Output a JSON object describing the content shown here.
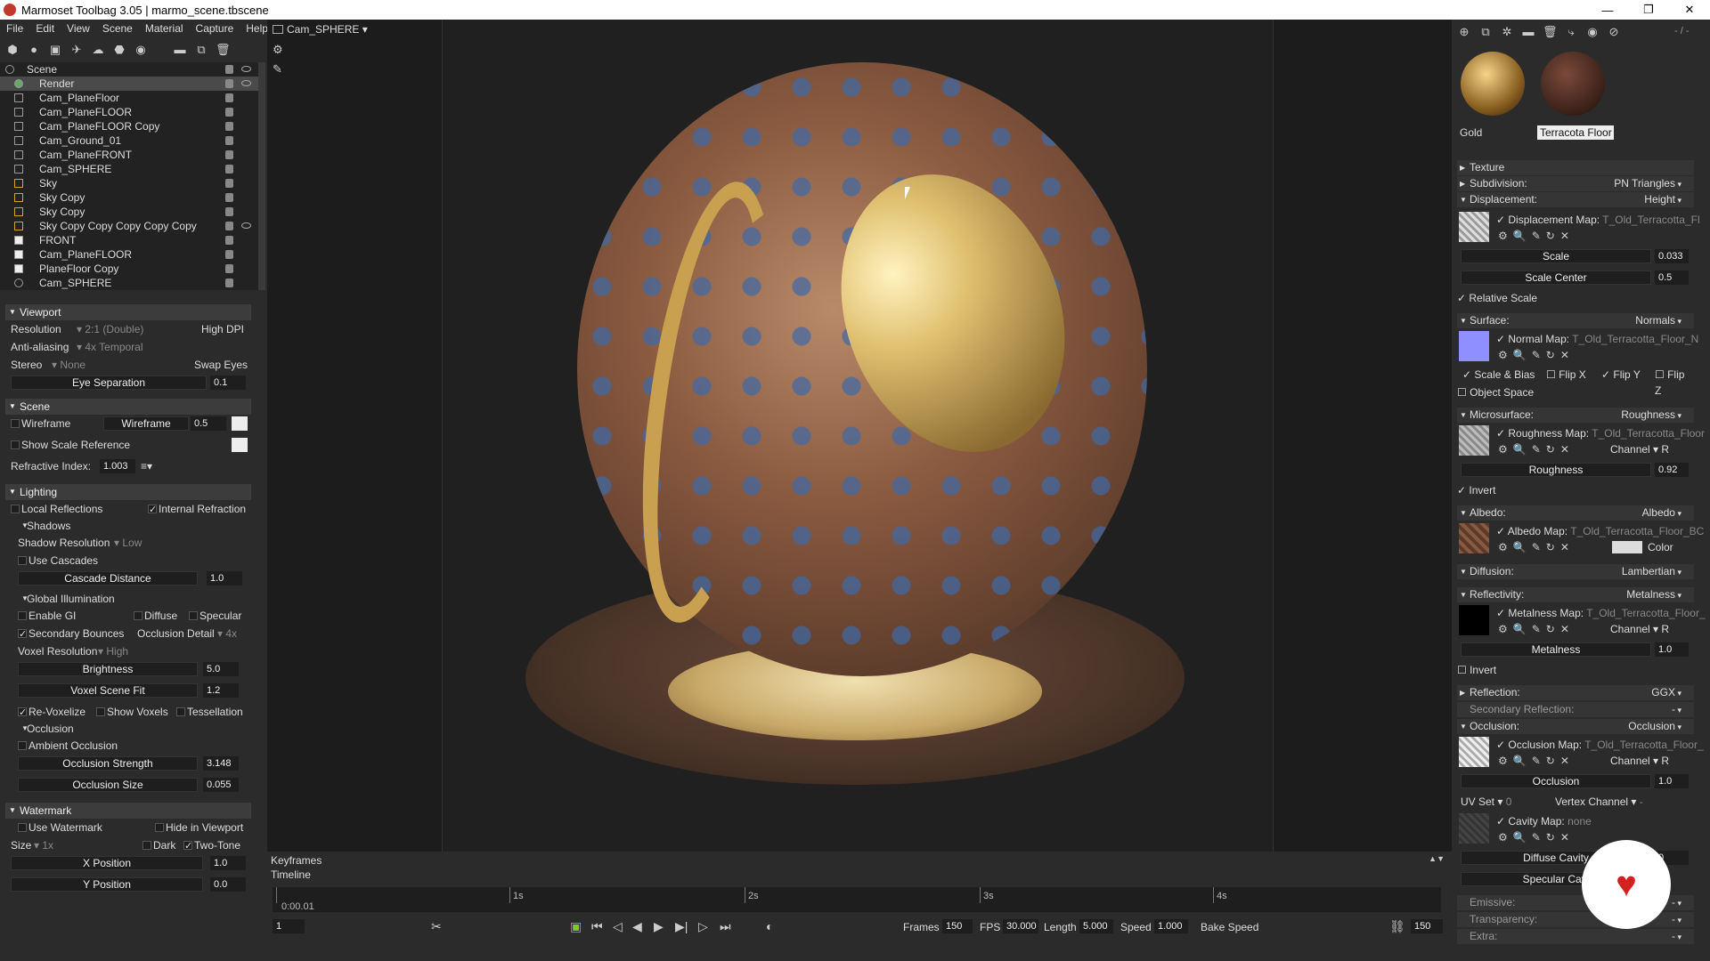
{
  "titlebar": {
    "app": "Marmoset Toolbag 3.05",
    "file": "marmo_scene.tbscene",
    "title": "Marmoset Toolbag 3.05 | marmo_scene.tbscene"
  },
  "menu": [
    "File",
    "Edit",
    "View",
    "Scene",
    "Material",
    "Capture",
    "Help"
  ],
  "camera_selector": "Cam_SPHERE",
  "scene_tree": [
    {
      "label": "Scene"
    },
    {
      "label": "Render"
    },
    {
      "label": "Cam_PlaneFloor"
    },
    {
      "label": "Cam_PlaneFLOOR"
    },
    {
      "label": "Cam_PlaneFLOOR Copy"
    },
    {
      "label": "Cam_Ground_01"
    },
    {
      "label": "Cam_PlaneFRONT"
    },
    {
      "label": "Cam_SPHERE"
    },
    {
      "label": "Sky"
    },
    {
      "label": "Sky Copy"
    },
    {
      "label": "Sky Copy"
    },
    {
      "label": "Sky Copy Copy Copy Copy Copy"
    },
    {
      "label": "FRONT"
    },
    {
      "label": "Cam_PlaneFLOOR"
    },
    {
      "label": "PlaneFloor Copy"
    },
    {
      "label": "Cam_SPHERE"
    }
  ],
  "viewport": {
    "header": "Viewport",
    "resolution_label": "Resolution",
    "resolution_value": "2:1 (Double)",
    "high_dpi": "High DPI",
    "aa_label": "Anti-aliasing",
    "aa_value": "4x Temporal",
    "stereo_label": "Stereo",
    "stereo_value": "None",
    "swap_eyes": "Swap Eyes",
    "eye_sep_label": "Eye Separation",
    "eye_sep_value": "0.1"
  },
  "scene": {
    "header": "Scene",
    "wireframe": "Wireframe",
    "wireframe_slider": "Wireframe",
    "wireframe_value": "0.5",
    "show_scale": "Show Scale Reference",
    "refractive_label": "Refractive Index:",
    "refractive_value": "1.003"
  },
  "lighting": {
    "header": "Lighting",
    "local_reflections": "Local Reflections",
    "internal_refraction": "Internal Refraction",
    "shadows": "Shadows",
    "shadow_res_label": "Shadow Resolution",
    "shadow_res_value": "Low",
    "use_cascades": "Use Cascades",
    "cascade_label": "Cascade Distance",
    "cascade_value": "1.0",
    "gi": "Global Illumination",
    "enable_gi": "Enable GI",
    "diffuse": "Diffuse",
    "specular": "Specular",
    "secondary_bounces": "Secondary Bounces",
    "occlusion_detail": "Occlusion Detail",
    "occlusion_detail_value": "4x",
    "voxel_res": "Voxel Resolution",
    "voxel_res_value": "High",
    "brightness_label": "Brightness",
    "brightness_value": "5.0",
    "voxel_fit_label": "Voxel Scene Fit",
    "voxel_fit_value": "1.2",
    "revoxelize": "Re-Voxelize",
    "show_voxels": "Show Voxels",
    "tessellation": "Tessellation",
    "occlusion": "Occlusion",
    "ambient_occlusion": "Ambient Occlusion",
    "occ_strength_label": "Occlusion Strength",
    "occ_strength_value": "3.148",
    "occ_size_label": "Occlusion Size",
    "occ_size_value": "0.055"
  },
  "watermark": {
    "header": "Watermark",
    "use_watermark": "Use Watermark",
    "hide_in_viewport": "Hide in Viewport",
    "size_label": "Size",
    "size_value": "1x",
    "dark": "Dark",
    "two_tone": "Two-Tone",
    "xpos_label": "X Position",
    "xpos_value": "1.0",
    "ypos_label": "Y Position",
    "ypos_value": "0.0"
  },
  "timeline": {
    "keyframes": "Keyframes",
    "timeline": "Timeline",
    "current_time": "0:00.01",
    "ticks": [
      "1s",
      "2s",
      "3s",
      "4s"
    ],
    "frame": "1",
    "frames_label": "Frames",
    "frames_value": "150",
    "fps_label": "FPS",
    "fps_value": "30.000",
    "length_label": "Length",
    "length_value": "5.000",
    "speed_label": "Speed",
    "speed_value": "1.000",
    "bake_speed": "Bake Speed",
    "end_frame": "150"
  },
  "materials": [
    {
      "name": "Gold",
      "color": "#c69a3c"
    },
    {
      "name": "Terracota Floor",
      "color": "#6a3a2a"
    }
  ],
  "material_counter": "- / -",
  "props": {
    "texture": "Texture",
    "subdivision": "Subdivision:",
    "subdivision_value": "PN Triangles",
    "displacement": "Displacement:",
    "displacement_value": "Height",
    "disp_map": "Displacement Map:",
    "disp_file": "T_Old_Terracotta_Fl",
    "scale_label": "Scale",
    "scale_value": "0.033",
    "scale_center_label": "Scale Center",
    "scale_center_value": "0.5",
    "relative_scale": "Relative Scale",
    "surface": "Surface:",
    "surface_value": "Normals",
    "normal_map": "Normal Map:",
    "normal_file": "T_Old_Terracotta_Floor_N",
    "scale_bias": "Scale & Bias",
    "flip_x": "Flip X",
    "flip_y": "Flip Y",
    "flip_z": "Flip Z",
    "object_space": "Object Space",
    "microsurface": "Microsurface:",
    "microsurface_value": "Roughness",
    "rough_map": "Roughness Map:",
    "rough_file": "T_Old_Terracotta_Floor",
    "channel": "Channel",
    "channel_r": "R",
    "roughness_label": "Roughness",
    "roughness_value": "0.92",
    "invert": "Invert",
    "albedo": "Albedo:",
    "albedo_value": "Albedo",
    "albedo_map": "Albedo Map:",
    "albedo_file": "T_Old_Terracotta_Floor_BC",
    "color": "Color",
    "diffusion": "Diffusion:",
    "diffusion_value": "Lambertian",
    "reflectivity": "Reflectivity:",
    "reflectivity_value": "Metalness",
    "metal_map": "Metalness Map:",
    "metal_file": "T_Old_Terracotta_Floor_",
    "metalness_label": "Metalness",
    "metalness_value": "1.0",
    "reflection": "Reflection:",
    "reflection_value": "GGX",
    "secondary_reflection": "Secondary Reflection:",
    "secondary_reflection_value": "-",
    "occlusion": "Occlusion:",
    "occlusion_value": "Occlusion",
    "occ_map": "Occlusion Map:",
    "occ_file": "T_Old_Terracotta_Floor_",
    "occ_label": "Occlusion",
    "occ_val": "1.0",
    "uv_set": "UV Set",
    "uv_value": "0",
    "vertex_channel": "Vertex Channel",
    "vertex_channel_value": "-",
    "cavity_map": "Cavity Map:",
    "cavity_file": "none",
    "diffuse_cavity": "Diffuse Cavity",
    "diffuse_cavity_value": "0",
    "specular_cavity": "Specular Cavi",
    "emissive": "Emissive:",
    "emissive_value": "-",
    "transparency": "Transparency:",
    "transparency_value": "-",
    "extra": "Extra:",
    "extra_value": "-"
  }
}
